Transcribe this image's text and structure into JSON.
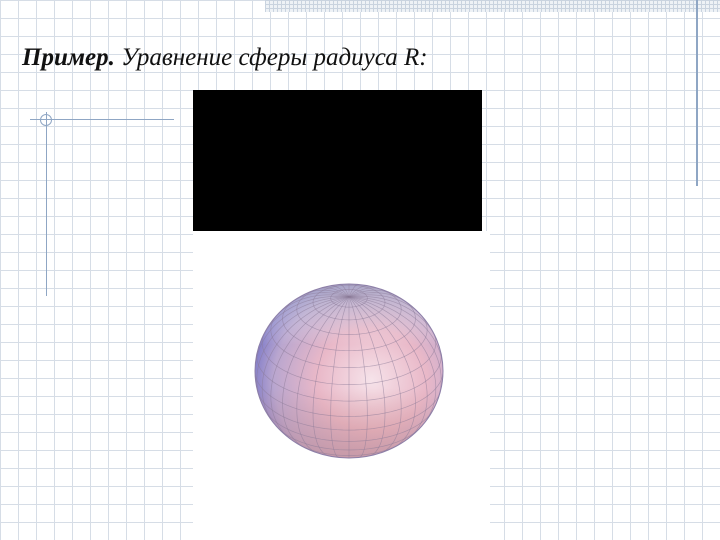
{
  "slide": {
    "title_bold": "Пример.",
    "title_rest": " Уравнение сферы радиуса R:"
  },
  "figure": {
    "type": "faceted sphere surface plot",
    "colors": {
      "top": "#a9a9c4",
      "left": "#7b78c8",
      "right": "#e9b8c8",
      "bottom": "#c98f8f",
      "highlight": "#f6e3ea"
    }
  }
}
